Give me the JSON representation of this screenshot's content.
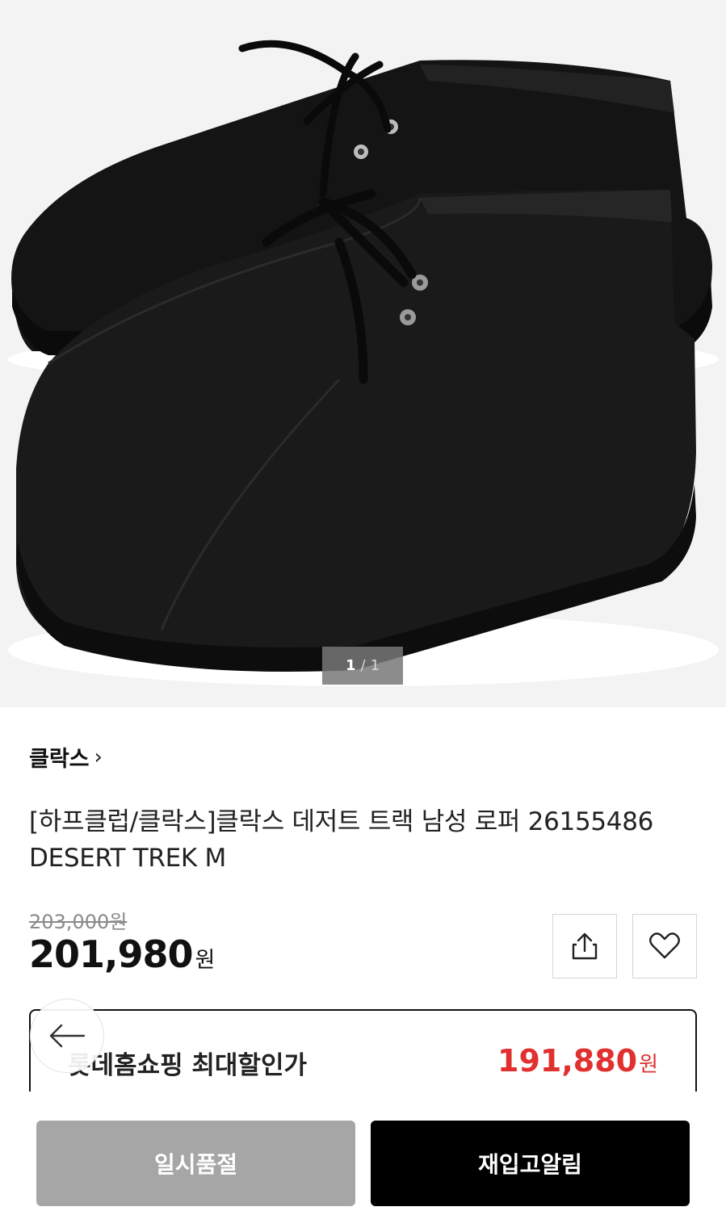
{
  "gallery": {
    "current": "1",
    "separator": "/",
    "total": "1"
  },
  "brand": {
    "name": "클락스"
  },
  "product": {
    "title_line1": "[하프클럽/클락스]클락스 데저트 트랙 남성 로퍼 26155486",
    "title_line2": "DESERT TREK M"
  },
  "pricing": {
    "original": "203,000원",
    "sale": "201,980",
    "currency": "원"
  },
  "max_discount": {
    "label": "롯데홈쇼핑 최대할인가",
    "value": "191,880",
    "currency": "원"
  },
  "actions": {
    "soldout_label": "일시품절",
    "restock_label": "재입고알림"
  },
  "colors": {
    "accent_red": "#e0302f",
    "primary_black": "#000000",
    "disabled_gray": "#a6a6a6"
  },
  "icons": {
    "share": "share-icon",
    "wish": "heart-icon",
    "back": "arrow-left-icon"
  }
}
